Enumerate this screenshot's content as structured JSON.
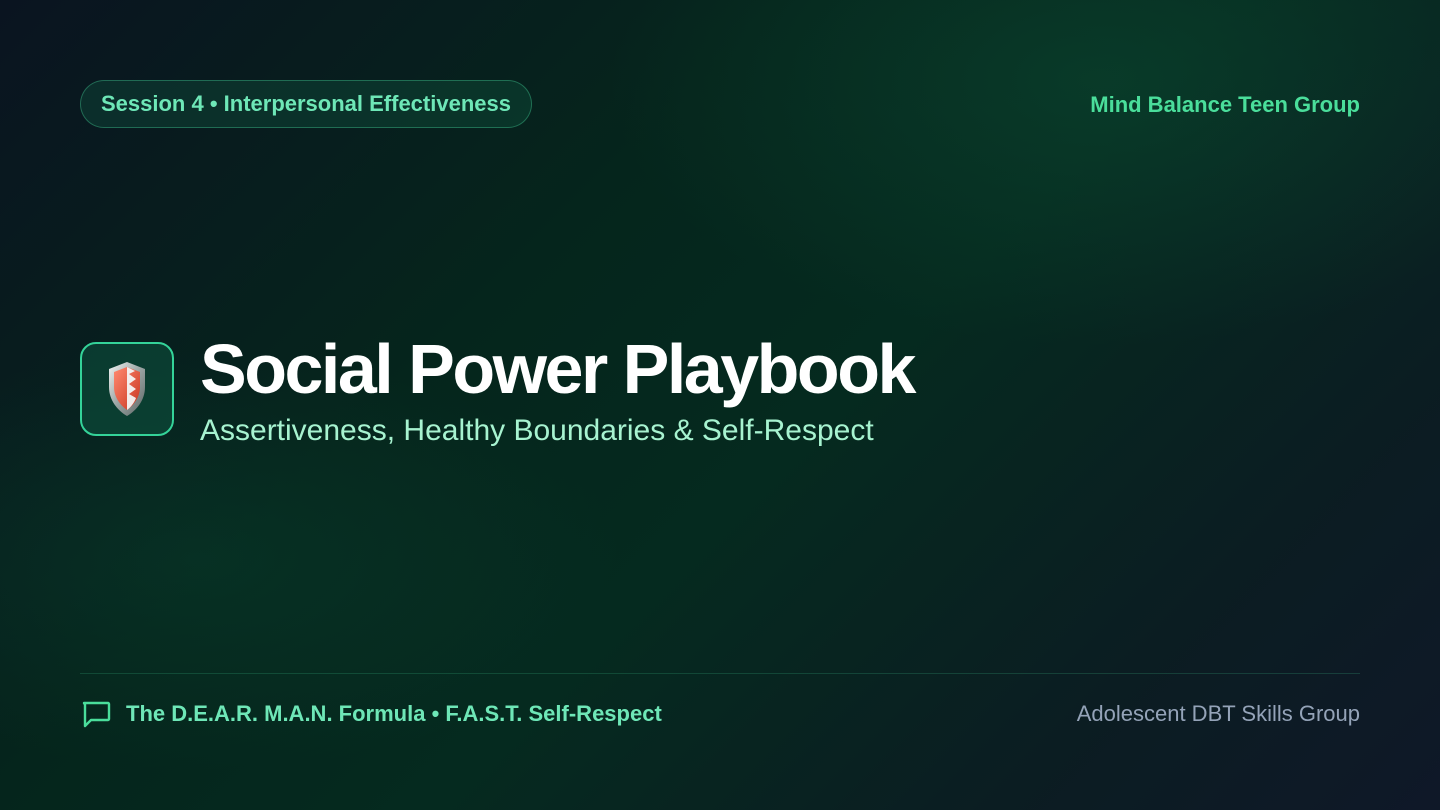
{
  "header": {
    "session_pill": "Session 4 • Interpersonal Effectiveness",
    "brand": "Mind Balance Teen Group"
  },
  "hero": {
    "icon": "shield-icon",
    "title": "Social Power Playbook",
    "subtitle": "Assertiveness, Healthy Boundaries & Self-Respect"
  },
  "footer": {
    "icon": "chat-bubble-icon",
    "topics": "The D.E.A.R. M.A.N. Formula • F.A.S.T. Self-Respect",
    "program": "Adolescent DBT Skills Group"
  },
  "colors": {
    "accent": "#4ade9b",
    "accent_light": "#a7f3d0",
    "title": "#ffffff",
    "muted": "#94a3b8"
  }
}
